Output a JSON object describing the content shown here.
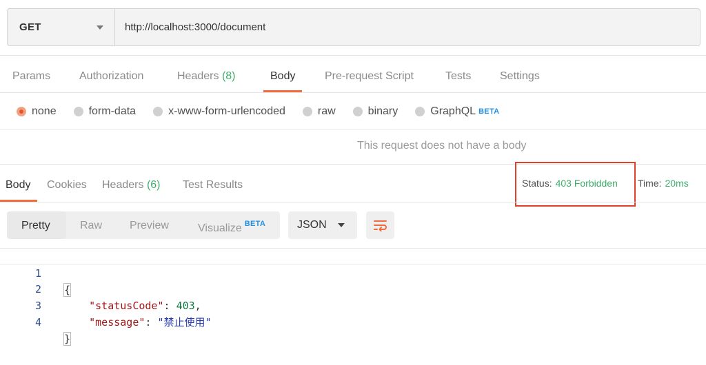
{
  "request": {
    "method": "GET",
    "url": "http://localhost:3000/document"
  },
  "request_tabs": [
    {
      "label": "Params"
    },
    {
      "label": "Authorization"
    },
    {
      "label": "Headers",
      "count": "(8)"
    },
    {
      "label": "Body",
      "active": true
    },
    {
      "label": "Pre-request Script"
    },
    {
      "label": "Tests"
    },
    {
      "label": "Settings"
    }
  ],
  "body_types": [
    {
      "label": "none",
      "selected": true
    },
    {
      "label": "form-data"
    },
    {
      "label": "x-www-form-urlencoded"
    },
    {
      "label": "raw"
    },
    {
      "label": "binary"
    },
    {
      "label": "GraphQL",
      "badge": "BETA"
    }
  ],
  "no_body_message": "This request does not have a body",
  "response_tabs": [
    {
      "label": "Body",
      "active": true
    },
    {
      "label": "Cookies"
    },
    {
      "label": "Headers",
      "count": "(6)"
    },
    {
      "label": "Test Results"
    }
  ],
  "response_meta": {
    "status_label": "Status:",
    "status_value": "403 Forbidden",
    "time_label": "Time:",
    "time_value": "20ms",
    "highlight_color": "#e0402a"
  },
  "view_modes": [
    {
      "label": "Pretty",
      "active": true
    },
    {
      "label": "Raw"
    },
    {
      "label": "Preview"
    },
    {
      "label": "Visualize",
      "badge": "BETA"
    }
  ],
  "format": "JSON",
  "code_lines": [
    {
      "n": "1",
      "text": "{"
    },
    {
      "n": "2",
      "key": "\"statusCode\"",
      "value": "403",
      "value_type": "number"
    },
    {
      "n": "3",
      "key": "\"message\"",
      "value": "\"禁止使用\"",
      "value_type": "string"
    },
    {
      "n": "4",
      "text": "}"
    }
  ],
  "colors": {
    "accent": "#f26b3a",
    "success": "#3cae6a",
    "beta": "#1f8fe5"
  }
}
